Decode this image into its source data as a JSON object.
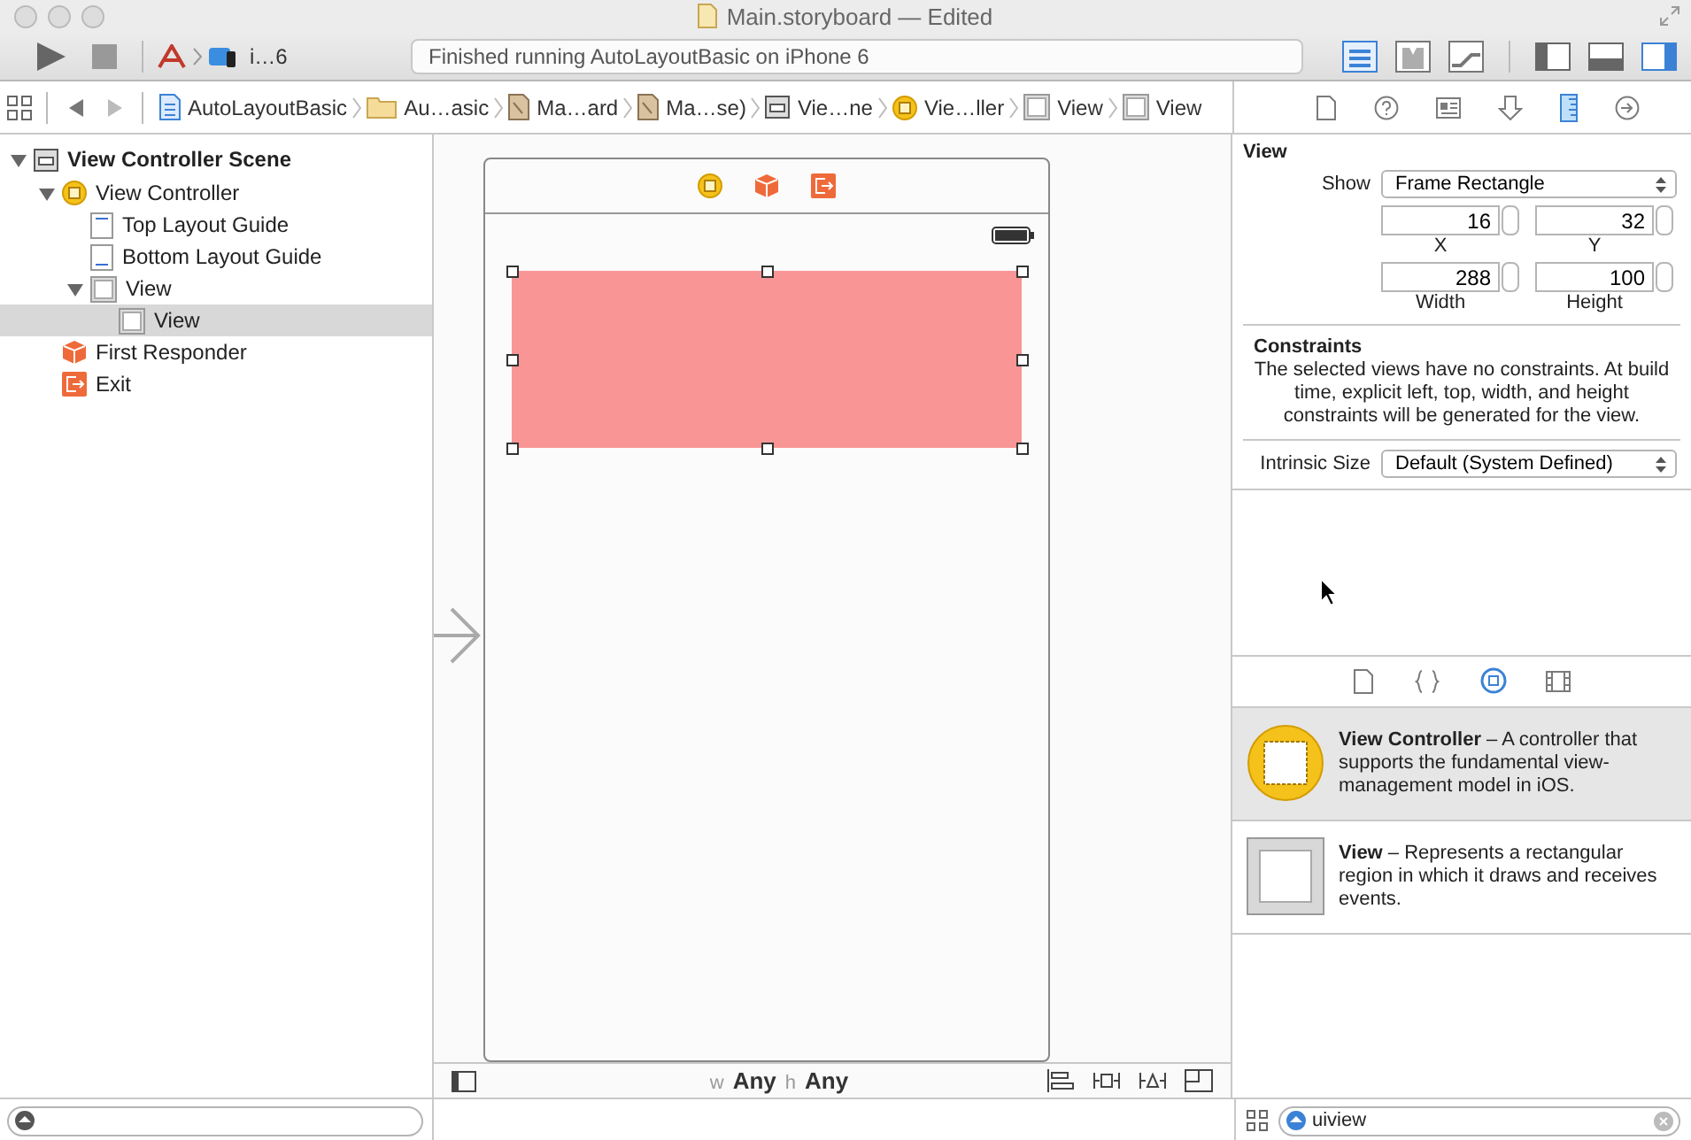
{
  "window": {
    "title": "Main.storyboard — Edited"
  },
  "toolbar": {
    "scheme": "i…6",
    "status": "Finished running AutoLayoutBasic on iPhone 6",
    "editor_modes": [
      {
        "kind": "standard",
        "selected": true
      },
      {
        "kind": "assistant",
        "selected": false
      },
      {
        "kind": "version",
        "selected": false
      }
    ],
    "panels": [
      {
        "kind": "navigator",
        "on": false
      },
      {
        "kind": "debug",
        "on": false
      },
      {
        "kind": "utilities",
        "on": true
      }
    ]
  },
  "breadcrumbs": [
    {
      "kind": "project",
      "label": "AutoLayoutBasic"
    },
    {
      "kind": "folder",
      "label": "Au…asic"
    },
    {
      "kind": "file",
      "label": "Ma…ard"
    },
    {
      "kind": "file",
      "label": "Ma…se)"
    },
    {
      "kind": "scene",
      "label": "Vie…ne"
    },
    {
      "kind": "controller",
      "label": "Vie…ller"
    },
    {
      "kind": "view",
      "label": "View"
    },
    {
      "kind": "view",
      "label": "View"
    }
  ],
  "inspector_tabs": [
    {
      "kind": "file",
      "selected": false
    },
    {
      "kind": "help",
      "selected": false
    },
    {
      "kind": "identity",
      "selected": false
    },
    {
      "kind": "attributes",
      "selected": false
    },
    {
      "kind": "size",
      "selected": true
    },
    {
      "kind": "connections",
      "selected": false
    }
  ],
  "outline": [
    {
      "kind": "scene",
      "label": "View Controller Scene",
      "expanded": true,
      "selected": false,
      "children": [
        {
          "kind": "controller",
          "label": "View Controller",
          "expanded": true,
          "selected": false,
          "children": [
            {
              "kind": "top-guide",
              "label": "Top Layout Guide",
              "selected": false
            },
            {
              "kind": "bottom-guide",
              "label": "Bottom Layout Guide",
              "selected": false
            },
            {
              "kind": "view",
              "label": "View",
              "expanded": true,
              "selected": false,
              "children": [
                {
                  "kind": "view",
                  "label": "View",
                  "selected": true
                }
              ]
            }
          ]
        },
        {
          "kind": "responder",
          "label": "First Responder",
          "selected": false
        },
        {
          "kind": "exit",
          "label": "Exit",
          "selected": false
        }
      ]
    }
  ],
  "inspector": {
    "title": "View",
    "show_label": "Show",
    "show_value": "Frame Rectangle",
    "fields": [
      {
        "value": "16",
        "label": "X"
      },
      {
        "value": "32",
        "label": "Y"
      },
      {
        "value": "288",
        "label": "Width"
      },
      {
        "value": "100",
        "label": "Height"
      }
    ],
    "constraints_title": "Constraints",
    "constraints_text": "The selected views have no constraints. At build time, explicit left, top, width, and height constraints will be generated for the view.",
    "intrinsic_label": "Intrinsic Size",
    "intrinsic_value": "Default (System Defined)"
  },
  "library_tabs": [
    {
      "kind": "file",
      "selected": false
    },
    {
      "kind": "snippet",
      "selected": false
    },
    {
      "kind": "object",
      "selected": true
    },
    {
      "kind": "media",
      "selected": false
    }
  ],
  "library_items": [
    {
      "kind": "controller",
      "title": "View Controller",
      "description": " – A controller that supports the fundamental view-management model in iOS.",
      "selected": true
    },
    {
      "kind": "view",
      "title": "View",
      "description": " – Represents a rectangular region in which it draws and receives events.",
      "selected": false
    }
  ],
  "size_class": {
    "width_label": "w",
    "width_value": "Any",
    "height_label": "h",
    "height_value": "Any"
  },
  "library_filter": {
    "value": "uiview"
  }
}
